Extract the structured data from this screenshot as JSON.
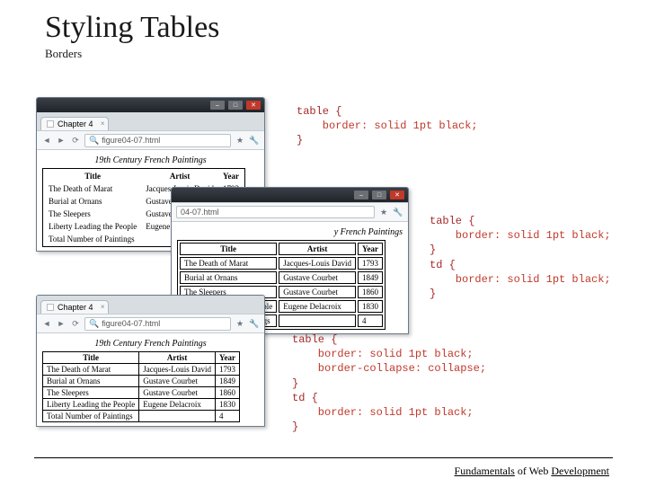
{
  "slide": {
    "title": "Styling Tables",
    "subtitle": "Borders"
  },
  "footer": {
    "w1": "Fundamentals",
    "w2": " of Web ",
    "w3": "Development"
  },
  "browser": {
    "tab_title": "Chapter 4",
    "url": "figure04-07.html",
    "page_caption": "19th Century French Paintings",
    "headers": {
      "title": "Title",
      "artist": "Artist",
      "year": "Year"
    },
    "rows": [
      {
        "t": "The Death of Marat",
        "a": "Jacques-Louis David",
        "y": "1793"
      },
      {
        "t": "Burial at Ornans",
        "a": "Gustave Courbet",
        "y": "1849"
      },
      {
        "t": "The Sleepers",
        "a": "Gustave Courbet",
        "y": "1860"
      },
      {
        "t": "Liberty Leading the People",
        "a": "Eugene Delacroix",
        "y": "1830"
      },
      {
        "t": "Total Number of Paintings",
        "a": "",
        "y": "4"
      }
    ]
  },
  "code1": {
    "sel": "table {",
    "prop": "    border: solid 1pt black;",
    "end": "}"
  },
  "code2": {
    "l1": "table {",
    "l2": "    border: solid 1pt black;",
    "l3": "}",
    "l4": "td {",
    "l5": "    border: solid 1pt black;",
    "l6": "}"
  },
  "code3": {
    "l1": "table {",
    "l2": "    border: solid 1pt black;",
    "l3": "    border-collapse: collapse;",
    "l4": "}",
    "l5": "td {",
    "l6": "    border: solid 1pt black;",
    "l7": "}"
  }
}
